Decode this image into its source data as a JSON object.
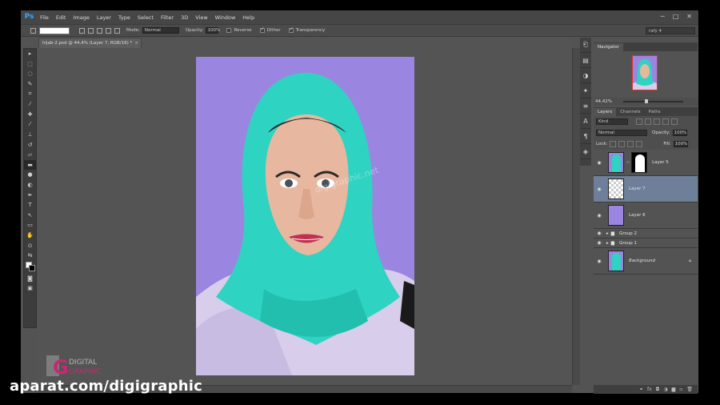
{
  "app": {
    "logo": "Ps"
  },
  "menu": [
    "File",
    "Edit",
    "Image",
    "Layer",
    "Type",
    "Select",
    "Filter",
    "3D",
    "View",
    "Window",
    "Help"
  ],
  "window_controls": [
    "─",
    "□",
    "✕"
  ],
  "options": {
    "mode_label": "Mode:",
    "mode_value": "Normal",
    "opacity_label": "Opacity:",
    "opacity_value": "100%",
    "reverse_label": "Reverse",
    "dither_label": "Dither",
    "transparency_label": "Transparency",
    "workspace_value": "rafy 4"
  },
  "document": {
    "tab_title": "hijab-2.psd @ 44,4% (Layer 7, RGB/16) *",
    "close": "×"
  },
  "canvas": {
    "watermark_text": "digigraphic.net",
    "bg_color": "#9a86e0"
  },
  "navigator": {
    "tab": "Navigator",
    "zoom": "44,42%"
  },
  "layers_panel": {
    "tabs": [
      "Layers",
      "Channels",
      "Paths"
    ],
    "filter_label": "Kind",
    "blend_mode": "Normal",
    "opacity_label": "Opacity:",
    "opacity_value": "100%",
    "lock_label": "Lock:",
    "fill_label": "Fill:",
    "fill_value": "100%",
    "layers": [
      {
        "name": "Layer 5",
        "type": "masked"
      },
      {
        "name": "Layer 7",
        "type": "transparent",
        "selected": true
      },
      {
        "name": "Layer 6",
        "type": "color"
      },
      {
        "name": "Group 2",
        "type": "group"
      },
      {
        "name": "Group 1",
        "type": "group"
      },
      {
        "name": "Background",
        "type": "background"
      }
    ]
  },
  "colors": {
    "accent": "#31a8ff",
    "selection": "#6e7f9a",
    "hijab": "#2fd3c2",
    "shawl": "#d8cdea"
  },
  "watermark": {
    "text": "aparat.com/digigraphic",
    "logo_text_1": "DIGITAL",
    "logo_text_2": "GRAPHIC"
  }
}
